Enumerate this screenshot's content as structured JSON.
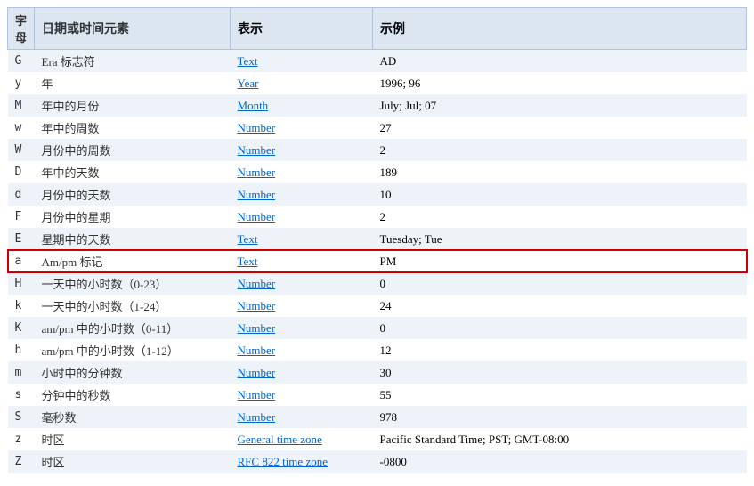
{
  "table": {
    "headers": [
      "字母",
      "日期或时间元素",
      "表示",
      "示例"
    ],
    "rows": [
      {
        "letter": "G",
        "desc": "Era 标志符",
        "repr": "Text",
        "repr_link": true,
        "example": "AD",
        "highlighted": false
      },
      {
        "letter": "y",
        "desc": "年",
        "repr": "Year",
        "repr_link": true,
        "example": "1996; 96",
        "highlighted": false
      },
      {
        "letter": "M",
        "desc": "年中的月份",
        "repr": "Month",
        "repr_link": true,
        "example": "July; Jul; 07",
        "highlighted": false
      },
      {
        "letter": "w",
        "desc": "年中的周数",
        "repr": "Number",
        "repr_link": true,
        "example": "27",
        "highlighted": false
      },
      {
        "letter": "W",
        "desc": "月份中的周数",
        "repr": "Number",
        "repr_link": true,
        "example": "2",
        "highlighted": false
      },
      {
        "letter": "D",
        "desc": "年中的天数",
        "repr": "Number",
        "repr_link": true,
        "example": "189",
        "highlighted": false
      },
      {
        "letter": "d",
        "desc": "月份中的天数",
        "repr": "Number",
        "repr_link": true,
        "example": "10",
        "highlighted": false
      },
      {
        "letter": "F",
        "desc": "月份中的星期",
        "repr": "Number",
        "repr_link": true,
        "example": "2",
        "highlighted": false
      },
      {
        "letter": "E",
        "desc": "星期中的天数",
        "repr": "Text",
        "repr_link": true,
        "example": "Tuesday; Tue",
        "highlighted": false
      },
      {
        "letter": "a",
        "desc": "Am/pm 标记",
        "repr": "Text",
        "repr_link": true,
        "example": "PM",
        "highlighted": true
      },
      {
        "letter": "H",
        "desc": "一天中的小时数（0-23）",
        "repr": "Number",
        "repr_link": true,
        "example": "0",
        "highlighted": false
      },
      {
        "letter": "k",
        "desc": "一天中的小时数（1-24）",
        "repr": "Number",
        "repr_link": true,
        "example": "24",
        "highlighted": false
      },
      {
        "letter": "K",
        "desc": "am/pm 中的小时数（0-11）",
        "repr": "Number",
        "repr_link": true,
        "example": "0",
        "highlighted": false
      },
      {
        "letter": "h",
        "desc": "am/pm 中的小时数（1-12）",
        "repr": "Number",
        "repr_link": true,
        "example": "12",
        "highlighted": false
      },
      {
        "letter": "m",
        "desc": "小时中的分钟数",
        "repr": "Number",
        "repr_link": true,
        "example": "30",
        "highlighted": false
      },
      {
        "letter": "s",
        "desc": "分钟中的秒数",
        "repr": "Number",
        "repr_link": true,
        "example": "55",
        "highlighted": false
      },
      {
        "letter": "S",
        "desc": "毫秒数",
        "repr": "Number",
        "repr_link": true,
        "example": "978",
        "highlighted": false
      },
      {
        "letter": "z",
        "desc": "时区",
        "repr": "General time zone",
        "repr_link": true,
        "example": "Pacific Standard Time; PST; GMT-08:00",
        "highlighted": false
      },
      {
        "letter": "Z",
        "desc": "时区",
        "repr": "RFC 822 time zone",
        "repr_link": true,
        "example": "-0800",
        "highlighted": false
      }
    ]
  }
}
